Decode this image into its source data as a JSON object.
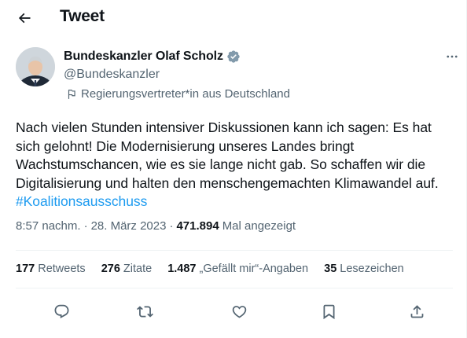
{
  "header": {
    "title": "Tweet",
    "back_icon": "arrow-left-icon"
  },
  "author": {
    "name": "Bundeskanzler Olaf Scholz",
    "handle": "@Bundeskanzler",
    "verified_icon": "verified-badge-icon",
    "label": "Regierungsvertreter*in aus Deutschland",
    "label_icon": "flag-icon"
  },
  "tweet": {
    "text": "Nach vielen Stunden intensiver Diskussionen kann ich sagen: Es hat sich gelohnt! Die Modernisierung unseres Landes bringt Wachstumschancen, wie es sie lange nicht gab. So schaffen wir die Digitalisierung und halten den menschengemachten Klimawandel auf. ",
    "hashtag": "#Koalitionsausschuss"
  },
  "meta": {
    "time": "8:57 nachm.",
    "date": "28. März 2023",
    "views": "471.894",
    "views_label": "Mal angezeigt"
  },
  "stats": [
    {
      "count": "177",
      "label": "Retweets"
    },
    {
      "count": "276",
      "label": "Zitate"
    },
    {
      "count": "1.487",
      "label": "„Gefällt mir“-Angaben"
    },
    {
      "count": "35",
      "label": "Lesezeichen"
    }
  ],
  "actions": [
    "reply-icon",
    "retweet-icon",
    "like-icon",
    "bookmark-icon",
    "share-icon"
  ],
  "colors": {
    "accent": "#1d9bf0",
    "text": "#0f1419",
    "secondary": "#536471",
    "divider": "#eff3f4"
  }
}
